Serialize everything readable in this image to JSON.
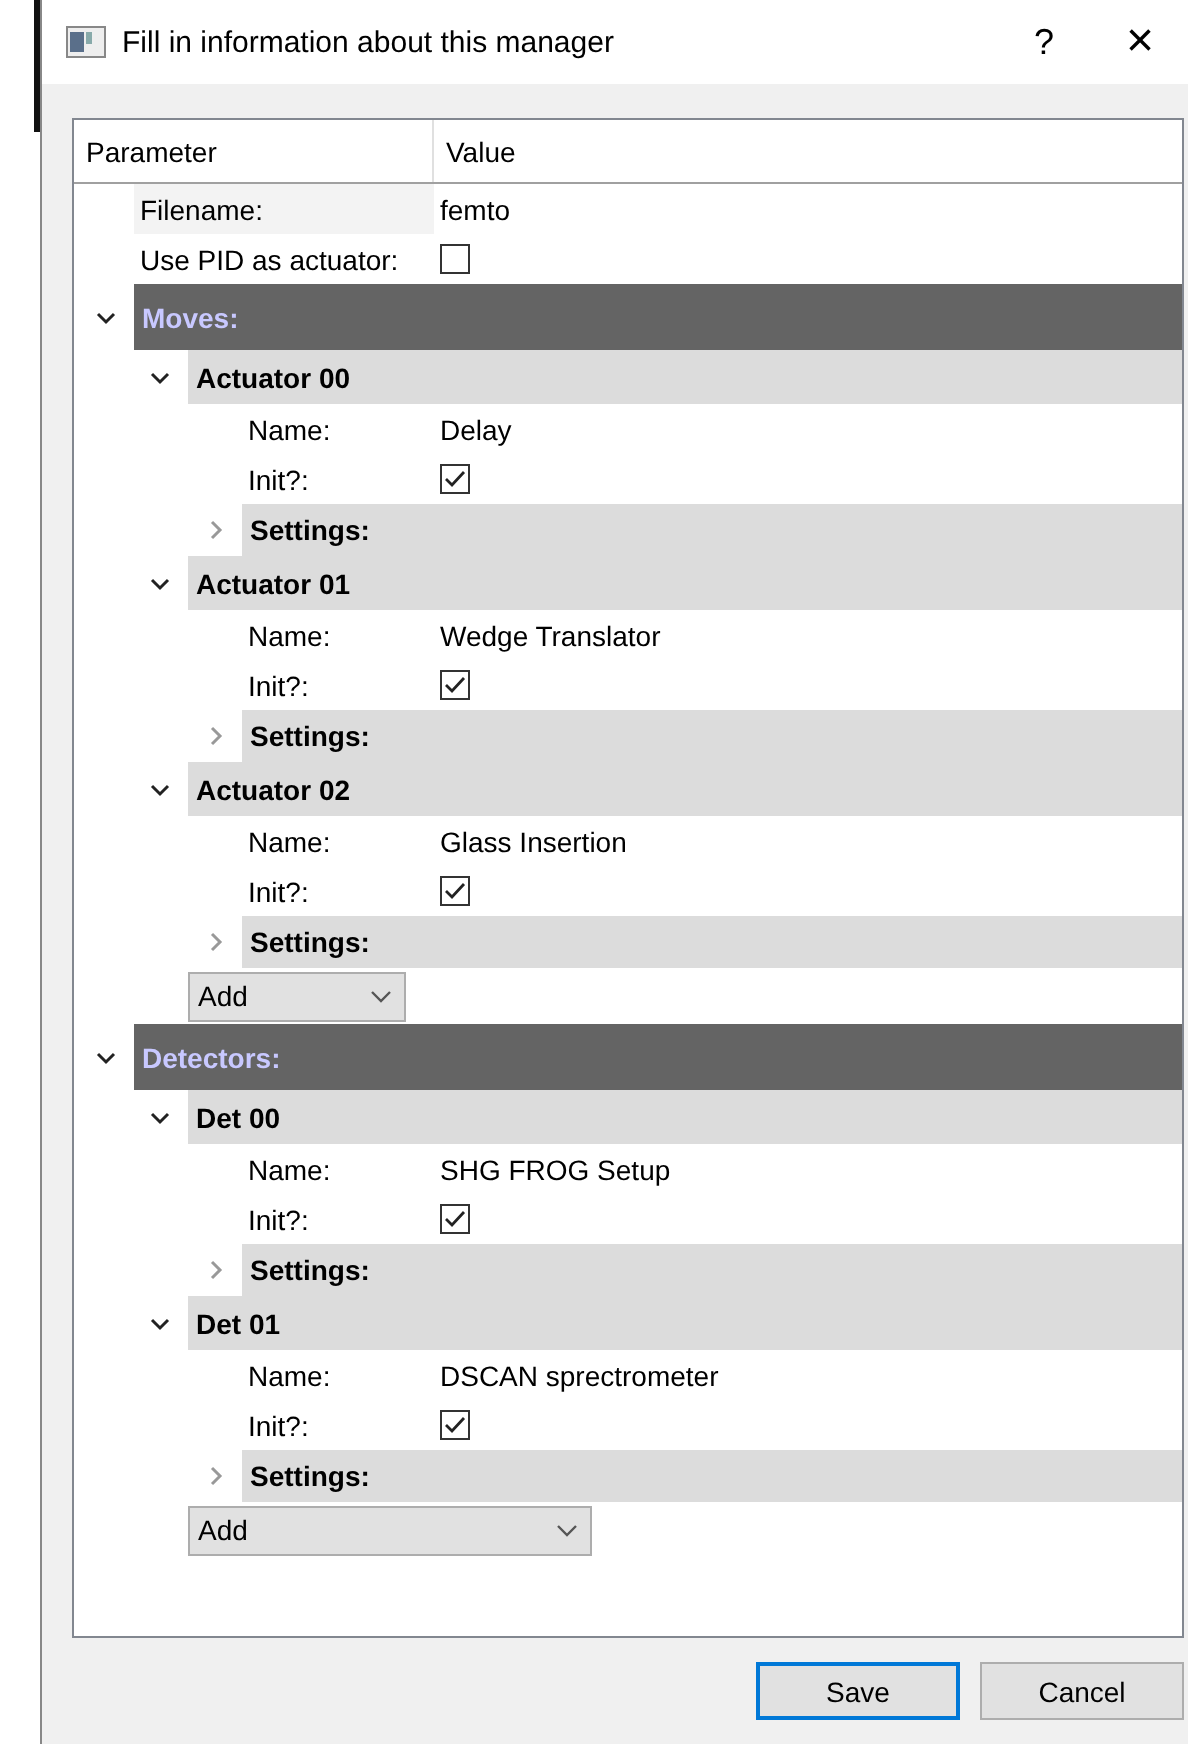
{
  "window": {
    "title": "Fill in information about this manager",
    "help": "?",
    "close": "×"
  },
  "tree": {
    "columns": [
      "Parameter",
      "Value"
    ],
    "params": [
      {
        "kind": "text",
        "label": "Filename:",
        "value": "femto"
      },
      {
        "kind": "checkbox",
        "label": "Use PID as actuator:",
        "checked": false
      }
    ],
    "groups": [
      {
        "title": "Moves:",
        "expanded": true,
        "add": "Add",
        "wide": false,
        "items": [
          {
            "title": "Actuator 00",
            "expanded": true,
            "params": [
              {
                "kind": "text",
                "label": "Name:",
                "value": "Delay"
              },
              {
                "kind": "checkbox",
                "label": "Init?:",
                "checked": true
              }
            ],
            "settings": {
              "label": "Settings:",
              "expanded": false
            }
          },
          {
            "title": "Actuator 01",
            "expanded": true,
            "params": [
              {
                "kind": "text",
                "label": "Name:",
                "value": "Wedge Translator"
              },
              {
                "kind": "checkbox",
                "label": "Init?:",
                "checked": true
              }
            ],
            "settings": {
              "label": "Settings:",
              "expanded": false
            }
          },
          {
            "title": "Actuator 02",
            "expanded": true,
            "params": [
              {
                "kind": "text",
                "label": "Name:",
                "value": "Glass Insertion"
              },
              {
                "kind": "checkbox",
                "label": "Init?:",
                "checked": true
              }
            ],
            "settings": {
              "label": "Settings:",
              "expanded": false
            }
          }
        ]
      },
      {
        "title": "Detectors:",
        "expanded": true,
        "add": "Add",
        "wide": true,
        "items": [
          {
            "title": "Det 00",
            "expanded": true,
            "params": [
              {
                "kind": "text",
                "label": "Name:",
                "value": "SHG FROG Setup"
              },
              {
                "kind": "checkbox",
                "label": "Init?:",
                "checked": true
              }
            ],
            "settings": {
              "label": "Settings:",
              "expanded": false
            }
          },
          {
            "title": "Det 01",
            "expanded": true,
            "params": [
              {
                "kind": "text",
                "label": "Name:",
                "value": "DSCAN sprectrometer"
              },
              {
                "kind": "checkbox",
                "label": "Init?:",
                "checked": true
              }
            ],
            "settings": {
              "label": "Settings:",
              "expanded": false
            }
          }
        ]
      }
    ]
  },
  "buttons": [
    {
      "label": "Save",
      "selected": true
    },
    {
      "label": "Cancel",
      "selected": false
    }
  ]
}
